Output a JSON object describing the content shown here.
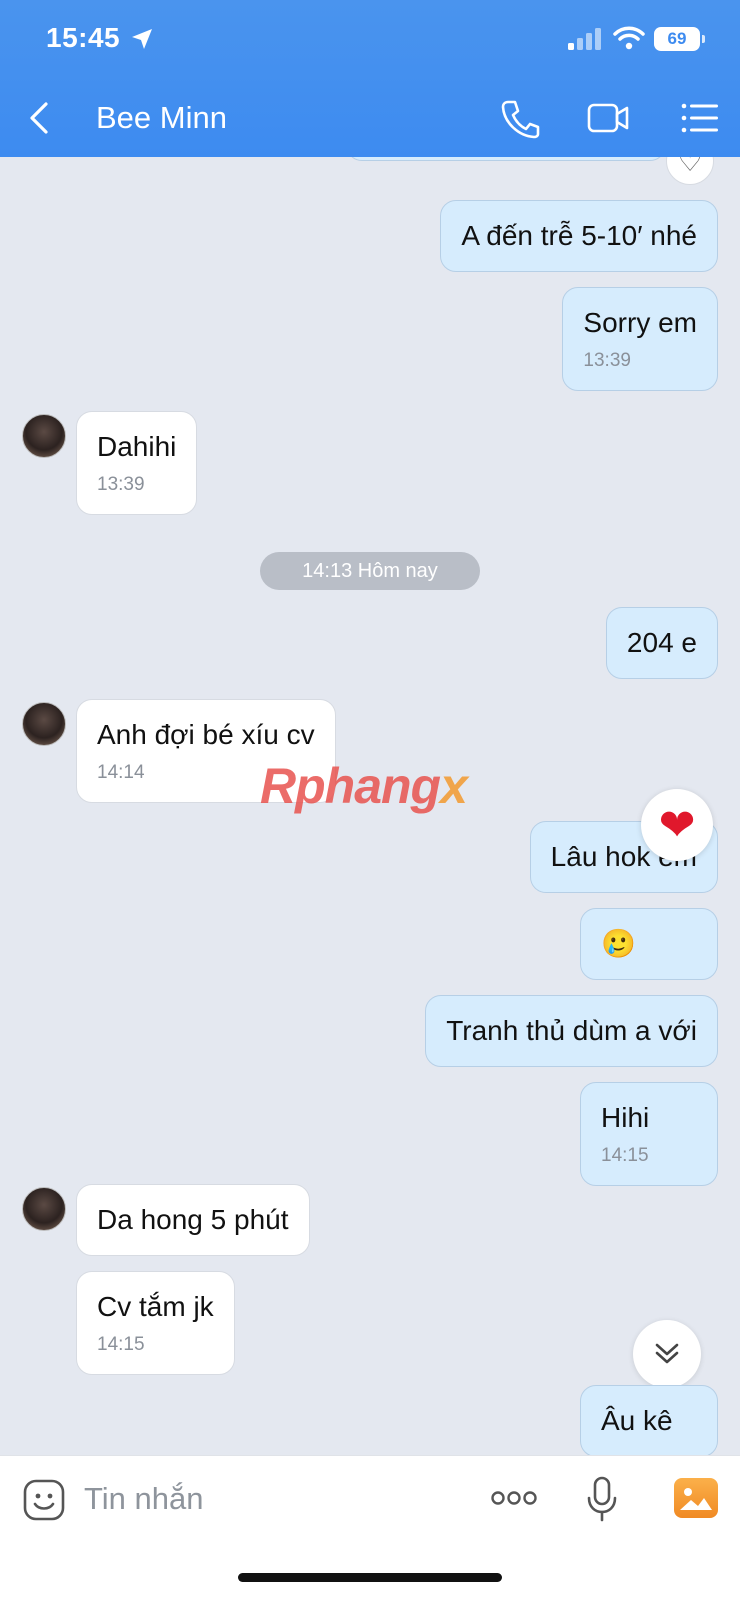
{
  "status_bar": {
    "time": "15:45",
    "battery": "69"
  },
  "header": {
    "title": "Bee Minn"
  },
  "chat": {
    "messages": [
      {
        "dir": "out",
        "text": "A đến trễ 5-10′ nhé",
        "time": ""
      },
      {
        "dir": "out",
        "text": "Sorry em",
        "time": "13:39"
      },
      {
        "dir": "in",
        "text": "Dahihi",
        "time": "13:39"
      },
      {
        "dir": "out",
        "text": "204 e",
        "time": ""
      },
      {
        "dir": "in",
        "text": "Anh đợi bé xíu cv",
        "time": "14:14"
      },
      {
        "dir": "out",
        "text": "Lâu hok em",
        "time": ""
      },
      {
        "dir": "out",
        "text": "🥲",
        "time": ""
      },
      {
        "dir": "out",
        "text": "Tranh thủ dùm a với",
        "time": ""
      },
      {
        "dir": "out",
        "text": "Hihi",
        "time": "14:15"
      },
      {
        "dir": "in",
        "text": "Da hong 5 phút",
        "time": ""
      },
      {
        "dir": "in",
        "text": "Cv tắm jk",
        "time": "14:15"
      },
      {
        "dir": "out",
        "text": "Âu kê",
        "time": ""
      }
    ],
    "date_separator": "14:13 Hôm nay",
    "reactions": {
      "outline_heart": "♡",
      "red_heart": "❤"
    },
    "watermark": {
      "main": "Rphang",
      "accent": "x"
    }
  },
  "input": {
    "placeholder": "Tin nhắn"
  },
  "colors": {
    "header": "#3d8bf0",
    "out_bubble": "#d6ecfd",
    "in_bubble": "#ffffff",
    "background": "#e4e8f0"
  },
  "icons": [
    "location-arrow-icon",
    "signal-icon",
    "wifi-icon",
    "back-chevron-icon",
    "phone-icon",
    "video-camera-icon",
    "list-menu-icon",
    "sticker-icon",
    "more-dots-icon",
    "microphone-icon",
    "image-icon",
    "double-chevron-down-icon"
  ]
}
